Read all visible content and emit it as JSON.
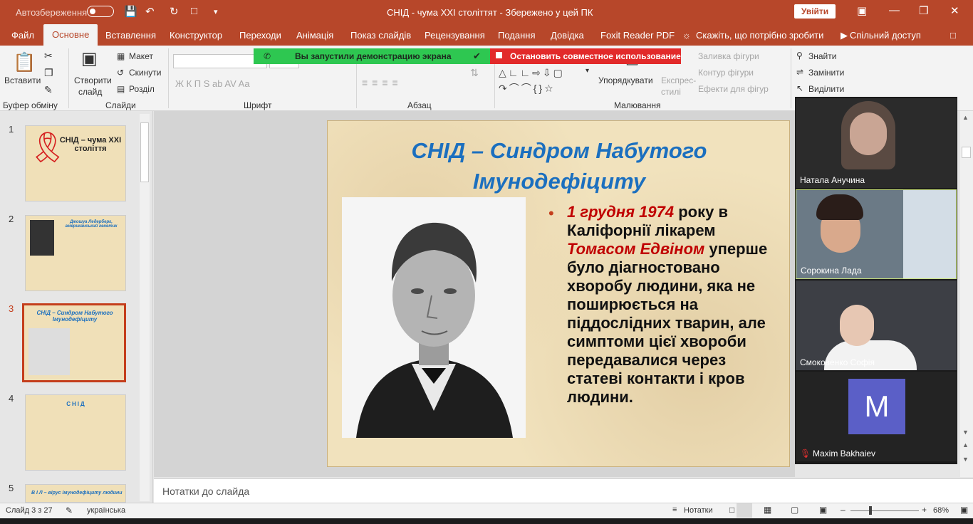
{
  "titlebar": {
    "autosave": "Автозбереження",
    "title": "СНІД - чума XXI століттят  -  Збережено у цей ПК",
    "signin": "Увійти"
  },
  "tabs": [
    "Файл",
    "Основне",
    "Вставлення",
    "Конструктор",
    "Переходи",
    "Анімація",
    "Показ слайдів",
    "Рецензування",
    "Подання",
    "Довідка",
    "Foxit Reader PDF",
    "Скажіть, що потрібно зробити",
    "Спільний доступ"
  ],
  "ribbon": {
    "paste": "Вставити",
    "clipboard": "Буфер обміну",
    "new_slide_1": "Створити",
    "new_slide_2": "слайд",
    "layout": "Макет",
    "reset": "Скинути",
    "section": "Розділ",
    "slides": "Слайди",
    "font_group": "Шрифт",
    "font_buttons": "Ж  К  П  S  ab  AV  Aa",
    "paragraph": "Абзац",
    "arrange": "Упорядкувати",
    "quick_styles_1": "Експрес-",
    "quick_styles_2": "стилі",
    "shape_fill": "Заливка фігури",
    "shape_outline": "Контур фігури",
    "shape_effects": "Ефекти для фігур",
    "drawing": "Малювання",
    "find": "Знайти",
    "replace": "Замінити",
    "select": "Виділити",
    "sharing_banner": "Вы запустили демонстрацию экрана",
    "stop_sharing": "Остановить совместное использование"
  },
  "thumbnails": [
    {
      "num": "1",
      "title": "СНІД – чума XXI століття"
    },
    {
      "num": "2",
      "title": "Джошуа Ледерберг, американський генетик"
    },
    {
      "num": "3",
      "title": "СНІД – Синдром Набутого Імунодефіциту"
    },
    {
      "num": "4",
      "title": "СНІД"
    },
    {
      "num": "5",
      "title": "В І Л – вірус імунодефіциту людини"
    }
  ],
  "slide": {
    "title_line1": "СНІД – Синдром Набутого",
    "title_line2": "Імунодефіциту",
    "date": "1 грудня 1974",
    "text_a": " року в Каліфорнії лікарем ",
    "doctor": "Томасом Едвіном",
    "text_b": " уперше було діагностовано хворобу людини, яка не поширюється на піддослідних тварин, але симптоми цієї хвороби передавалися через статеві контакти і кров людини."
  },
  "notes_placeholder": "Нотатки до слайда",
  "participants": [
    {
      "name": "Натала Анучина"
    },
    {
      "name": "Сорокина Лада"
    },
    {
      "name": "Смоковенко Софія"
    },
    {
      "name": "Maxim Bakhaiev",
      "initial": "M"
    }
  ],
  "status": {
    "slide": "Слайд 3 з 27",
    "language": "українська",
    "notes": "Нотатки",
    "zoom": "68%"
  },
  "colors": {
    "accent": "#b7472a",
    "title_blue": "#1b6fbf",
    "highlight_red": "#c00000"
  }
}
